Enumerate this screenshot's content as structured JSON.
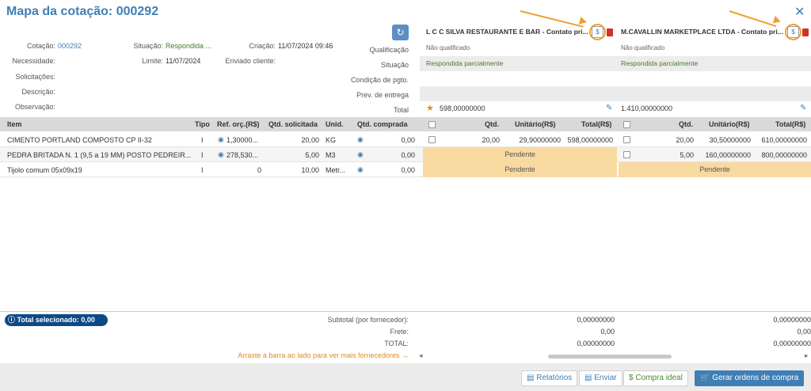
{
  "header": {
    "title": "Mapa da cotação: 000292"
  },
  "info": {
    "cotacao_label": "Cotação:",
    "cotacao_value": "000292",
    "situacao_label": "Situação:",
    "situacao_value": "Respondida ...",
    "criacao_label": "Criação:",
    "criacao_value": "11/07/2024 09:46",
    "necessidade_label": "Necessidade:",
    "limite_label": "Limite:",
    "limite_value": "11/07/2024",
    "enviado_label": "Enviado cliente:",
    "solicitacoes_label": "Solicitações:",
    "descricao_label": "Descrição:",
    "observacao_label": "Observação:"
  },
  "comparison_labels": {
    "qualificacao": "Qualificação",
    "situacao": "Situação",
    "condicao": "Condição de pgto.",
    "prev_entrega": "Prev. de entrega",
    "total": "Total"
  },
  "suppliers": [
    {
      "name": "L C C SILVA RESTAURANTE E BAR - Contato pri...",
      "dollar": "$",
      "qualificacao": "Não qualificado",
      "situacao": "Respondida parcialmente",
      "total": "598,00000000"
    },
    {
      "name": "M.CAVALLIN MARKETPLACE LTDA - Contato pri...",
      "dollar": "$",
      "qualificacao": "Não qualificado",
      "situacao": "Respondida parcialmente",
      "total": "1.410,00000000"
    }
  ],
  "table": {
    "headers": [
      "Item",
      "Tipo",
      "Ref. orç.(R$)",
      "Qtd. solicitada",
      "Unid.",
      "Qtd. comprada"
    ],
    "supplier_headers": [
      "Qtd.",
      "Unitário(R$)",
      "Total(R$)"
    ],
    "rows": [
      {
        "item": "CIMENTO PORTLAND COMPOSTO CP II-32",
        "tipo": "I",
        "ref": "1,30000...",
        "qtd_sol": "20,00",
        "unid": "KG",
        "qtd_comp": "0,00",
        "s1": {
          "qtd": "20,00",
          "unit": "29,90000000",
          "total": "598,00000000"
        },
        "s2": {
          "qtd": "20,00",
          "unit": "30,50000000",
          "total": "610,00000000"
        }
      },
      {
        "item": "PEDRA BRITADA N. 1 (9,5 a 19 MM) POSTO PEDREIR...",
        "tipo": "I",
        "ref": "278,530...",
        "qtd_sol": "5,00",
        "unid": "M3",
        "qtd_comp": "0,00",
        "s1": {
          "pending": "Pendente"
        },
        "s2": {
          "qtd": "5,00",
          "unit": "160,00000000",
          "total": "800,00000000"
        }
      },
      {
        "item": "Tijolo comum 05x09x19",
        "tipo": "I",
        "ref": "0",
        "qtd_sol": "10,00",
        "unid": "Metr...",
        "qtd_comp": "0,00",
        "s1": {
          "pending": "Pendente"
        },
        "s2": {
          "pending": "Pendente"
        }
      }
    ]
  },
  "footer": {
    "total_selecionado": "Total selecionado: 0,00",
    "subtotal_label": "Subtotal (por fornecedor):",
    "frete_label": "Frete:",
    "total_label": "TOTAL:",
    "hint": "Arraste a barra ao lado para ver mais fornecedores →",
    "s1": {
      "subtotal": "0,00000000",
      "frete": "0,00",
      "total": "0,00000000"
    },
    "s2": {
      "subtotal": "0,00000000",
      "frete": "0,00",
      "total": "0,00000000"
    }
  },
  "actions": {
    "relatorios": "Relatórios",
    "enviar": "Enviar",
    "compra_ideal": "Compra ideal",
    "gerar": "Gerar ordens de compra"
  },
  "colors": {
    "accent": "#3f7fb5",
    "pending": "#f8d9a0",
    "annotation": "#f0a030"
  }
}
